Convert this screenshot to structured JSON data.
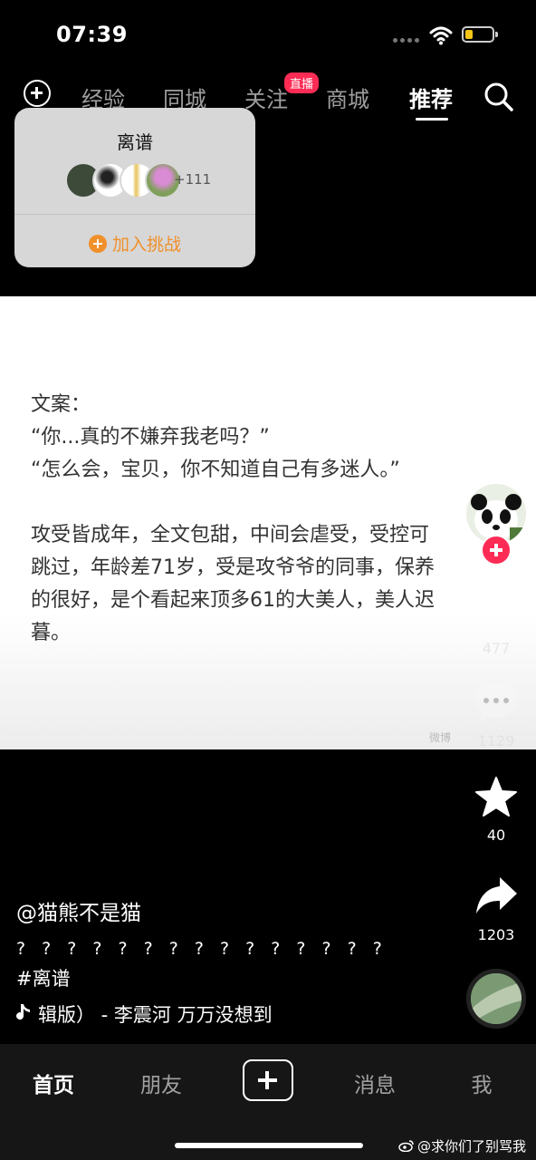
{
  "status_bar": {
    "time": "07:39",
    "battery_color": "#f5c518"
  },
  "top_nav": {
    "tabs": [
      {
        "label": "经验",
        "active": false
      },
      {
        "label": "同城",
        "active": false
      },
      {
        "label": "关注",
        "active": false
      },
      {
        "label": "商城",
        "active": false
      },
      {
        "label": "推荐",
        "active": true
      }
    ],
    "live_badge": "直播"
  },
  "challenge_popup": {
    "title": "离谱",
    "participant_count": "+111",
    "join_label": "加入挑战"
  },
  "post": {
    "text": "文案：\n“你...真的不嫌弃我老吗？”\n“怎么会，宝贝，你不知道自己有多迷人。”\n\n攻受皆成年，全文包甜，中间会虐受，受控可\n跳过，年龄差71岁，受是攻爷爷的同事，保养\n的很好，是个看起来顶多61的大美人，美人迟\n暮。"
  },
  "actions": {
    "likes": "477",
    "comments": "1129",
    "favorites": "40",
    "shares": "1203"
  },
  "video_info": {
    "author": "@猫熊不是猫",
    "description": "? ? ? ? ? ? ? ? ? ? ? ? ? ? ?",
    "hashtag": "#离谱",
    "music": "辑版） - 李震河    万万没想到"
  },
  "bottom_nav": {
    "items": [
      {
        "label": "首页",
        "active": true
      },
      {
        "label": "朋友",
        "active": false
      },
      {
        "label": "消息",
        "active": false
      },
      {
        "label": "我",
        "active": false
      }
    ]
  },
  "watermark": "@求你们了别骂我",
  "colors": {
    "accent_red": "#fe2c55",
    "join_orange": "#f0902a"
  }
}
